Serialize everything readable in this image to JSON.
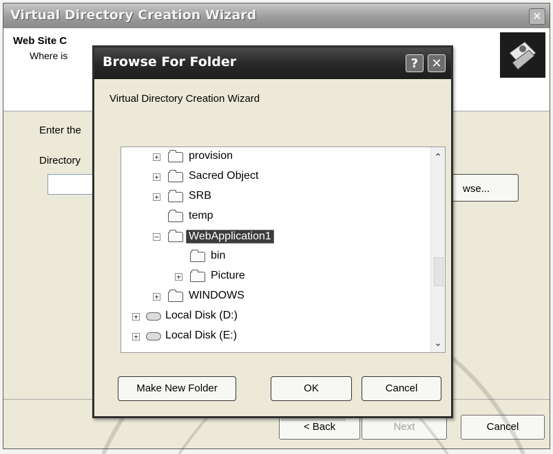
{
  "wizard": {
    "title": "Virtual Directory Creation Wizard",
    "header_title": "Web Site C",
    "header_subtitle": "Where is",
    "body_text_1": "Enter the",
    "body_text_2": "Directory",
    "browse_button": "wse...",
    "back_button": "< Back",
    "next_button": "Next",
    "cancel_button": "Cancel"
  },
  "dialog": {
    "title": "Browse For Folder",
    "help_glyph": "?",
    "close_glyph": "✕",
    "description": "Virtual Directory Creation Wizard",
    "tree": [
      {
        "label": "provision",
        "expander": "+",
        "icon": "folder-icon"
      },
      {
        "label": "Sacred Object",
        "expander": "+",
        "icon": "folder-icon"
      },
      {
        "label": "SRB",
        "expander": "+",
        "icon": "folder-icon"
      },
      {
        "label": "temp",
        "expander": "",
        "icon": "folder-icon"
      },
      {
        "label": "WebApplication1",
        "expander": "−",
        "icon": "folder-icon",
        "selected": true
      },
      {
        "label": "bin",
        "expander": "",
        "icon": "folder-icon"
      },
      {
        "label": "Picture",
        "expander": "+",
        "icon": "folder-icon"
      },
      {
        "label": "WINDOWS",
        "expander": "+",
        "icon": "folder-icon"
      },
      {
        "label": "Local Disk (D:)",
        "expander": "+",
        "icon": "disk-icon"
      },
      {
        "label": "Local Disk (E:)",
        "expander": "+",
        "icon": "disk-icon"
      }
    ],
    "make_new_folder_button": "Make New Folder",
    "ok_button": "OK",
    "cancel_button": "Cancel"
  },
  "colors": {
    "dialog_title_bar": "#2a2a2a",
    "selection": "#3c3c3c",
    "window_face": "#ece9d8"
  }
}
